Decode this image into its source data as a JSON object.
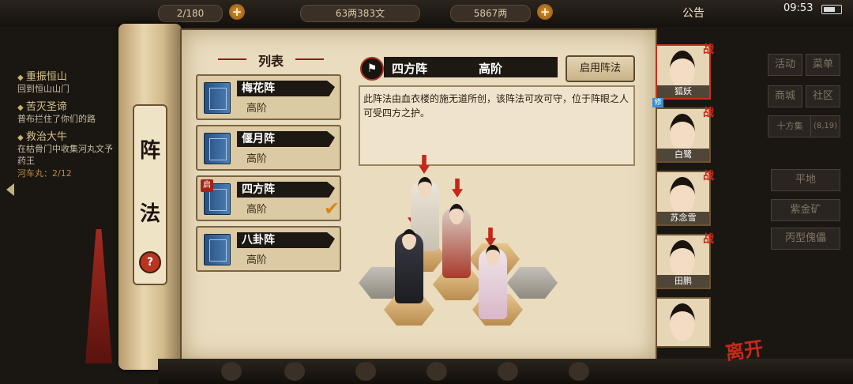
{
  "topbar": {
    "capacity_label": "2/180",
    "silver": "63两383文",
    "gold": "5867两",
    "notice": "公告",
    "time": "09:53"
  },
  "quests": [
    {
      "title": "重振恒山",
      "desc": "回到恒山山门"
    },
    {
      "title": "苦灭圣谛",
      "desc": "普布拦住了你们的路"
    },
    {
      "title": "救治大牛",
      "desc": "在枯骨门中收集河丸文予药王"
    }
  ],
  "quest_extra": "河车丸：2/12",
  "scroll": {
    "char1": "阵",
    "char2": "法",
    "help": "?"
  },
  "list": {
    "header": "列表",
    "items": [
      {
        "name": "梅花阵",
        "rank": "高阶"
      },
      {
        "name": "偃月阵",
        "rank": "高阶"
      },
      {
        "name": "四方阵",
        "rank": "高阶",
        "tag": "启"
      },
      {
        "name": "八卦阵",
        "rank": "高阶"
      }
    ]
  },
  "detail": {
    "name": "四方阵",
    "rank": "高阶",
    "enable_button": "启用阵法",
    "description": "此阵法由血衣楼的施无道所创，该阵法可攻可守，位于阵眼之人可受四方之护。"
  },
  "heroes": [
    {
      "name": "狐妖",
      "badge": "战"
    },
    {
      "name": "白鹭",
      "badge": "战"
    },
    {
      "name": "苏念雪",
      "badge": "战"
    },
    {
      "name": "田鹏",
      "badge": "战"
    },
    {
      "name": "",
      "badge": ""
    }
  ],
  "hero_tag": "修",
  "side": {
    "btn1": "活动",
    "btn2": "菜单",
    "btn3": "商城",
    "btn4": "社区",
    "location": "十方集",
    "coords": "(8,19)",
    "terrain": "平地",
    "ore": "紫金矿",
    "item": "丙型傀儡"
  },
  "leave": "离开",
  "colors": {
    "accent_red": "#c2331f",
    "paper": "#e9dcbf",
    "ink": "#1d1812"
  }
}
